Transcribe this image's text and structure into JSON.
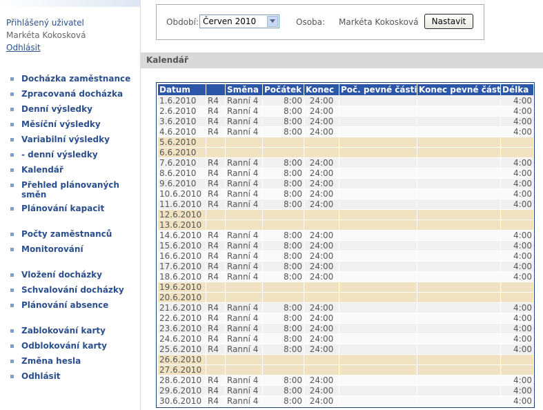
{
  "sidebar": {
    "user_title": "Přihlášený uživatel",
    "user_name": "Markéta Kokosková",
    "logout_label": "Odhlásit",
    "groups": [
      [
        "Docházka zaměstnance",
        "Zpracovaná docházka",
        "Denní výsledky",
        "Měsíční výsledky",
        "Variabilní výsledky",
        "- denní výsledky",
        "Kalendář",
        "Přehled plánovaných směn",
        "Plánování kapacit"
      ],
      [
        "Počty zaměstnanců",
        "Monitorování"
      ],
      [
        "Vložení docházky",
        "Schvalování docházky",
        "Plánování absence"
      ],
      [
        "Zablokování karty",
        "Odblokování karty",
        "Změna hesla",
        "Odhlásit"
      ]
    ]
  },
  "filter": {
    "period_label": "Období:",
    "period_value": "Červen 2010",
    "person_label": "Osoba:",
    "person_value": "Markéta Kokosková",
    "set_button": "Nastavit"
  },
  "section_title": "Kalendář",
  "calendar": {
    "headers": [
      "Datum",
      "",
      "Směna",
      "Počátek",
      "Konec",
      "Poč. pevné části",
      "Konec pevné části",
      "Délka"
    ],
    "rows": [
      [
        "1.6.2010",
        "R4",
        "Ranní 4",
        "8:00",
        "24:00",
        "",
        "",
        "4:00"
      ],
      [
        "2.6.2010",
        "R4",
        "Ranní 4",
        "8:00",
        "24:00",
        "",
        "",
        "4:00"
      ],
      [
        "3.6.2010",
        "R4",
        "Ranní 4",
        "8:00",
        "24:00",
        "",
        "",
        "4:00"
      ],
      [
        "4.6.2010",
        "R4",
        "Ranní 4",
        "8:00",
        "24:00",
        "",
        "",
        "4:00"
      ],
      [
        "5.6.2010",
        "",
        "",
        "",
        "",
        "",
        "",
        ""
      ],
      [
        "6.6.2010",
        "",
        "",
        "",
        "",
        "",
        "",
        ""
      ],
      [
        "7.6.2010",
        "R4",
        "Ranní 4",
        "8:00",
        "24:00",
        "",
        "",
        "4:00"
      ],
      [
        "8.6.2010",
        "R4",
        "Ranní 4",
        "8:00",
        "24:00",
        "",
        "",
        "4:00"
      ],
      [
        "9.6.2010",
        "R4",
        "Ranní 4",
        "8:00",
        "24:00",
        "",
        "",
        "4:00"
      ],
      [
        "10.6.2010",
        "R4",
        "Ranní 4",
        "8:00",
        "24:00",
        "",
        "",
        "4:00"
      ],
      [
        "11.6.2010",
        "R4",
        "Ranní 4",
        "8:00",
        "24:00",
        "",
        "",
        "4:00"
      ],
      [
        "12.6.2010",
        "",
        "",
        "",
        "",
        "",
        "",
        ""
      ],
      [
        "13.6.2010",
        "",
        "",
        "",
        "",
        "",
        "",
        ""
      ],
      [
        "14.6.2010",
        "R4",
        "Ranní 4",
        "8:00",
        "24:00",
        "",
        "",
        "4:00"
      ],
      [
        "15.6.2010",
        "R4",
        "Ranní 4",
        "8:00",
        "24:00",
        "",
        "",
        "4:00"
      ],
      [
        "16.6.2010",
        "R4",
        "Ranní 4",
        "8:00",
        "24:00",
        "",
        "",
        "4:00"
      ],
      [
        "17.6.2010",
        "R4",
        "Ranní 4",
        "8:00",
        "24:00",
        "",
        "",
        "4:00"
      ],
      [
        "18.6.2010",
        "R4",
        "Ranní 4",
        "8:00",
        "24:00",
        "",
        "",
        "4:00"
      ],
      [
        "19.6.2010",
        "",
        "",
        "",
        "",
        "",
        "",
        ""
      ],
      [
        "20.6.2010",
        "",
        "",
        "",
        "",
        "",
        "",
        ""
      ],
      [
        "21.6.2010",
        "R4",
        "Ranní 4",
        "8:00",
        "24:00",
        "",
        "",
        "4:00"
      ],
      [
        "22.6.2010",
        "R4",
        "Ranní 4",
        "8:00",
        "24:00",
        "",
        "",
        "4:00"
      ],
      [
        "23.6.2010",
        "R4",
        "Ranní 4",
        "8:00",
        "24:00",
        "",
        "",
        "4:00"
      ],
      [
        "24.6.2010",
        "R4",
        "Ranní 4",
        "8:00",
        "24:00",
        "",
        "",
        "4:00"
      ],
      [
        "25.6.2010",
        "R4",
        "Ranní 4",
        "8:00",
        "24:00",
        "",
        "",
        "4:00"
      ],
      [
        "26.6.2010",
        "",
        "",
        "",
        "",
        "",
        "",
        ""
      ],
      [
        "27.6.2010",
        "",
        "",
        "",
        "",
        "",
        "",
        ""
      ],
      [
        "28.6.2010",
        "R4",
        "Ranní 4",
        "8:00",
        "24:00",
        "",
        "",
        "4:00"
      ],
      [
        "29.6.2010",
        "R4",
        "Ranní 4",
        "8:00",
        "24:00",
        "",
        "",
        "4:00"
      ],
      [
        "30.6.2010",
        "R4",
        "Ranní 4",
        "8:00",
        "24:00",
        "",
        "",
        "4:00"
      ]
    ]
  },
  "colors": {
    "header_bg": "#2c56a7",
    "weekend_bg": "#f1e3c1",
    "link": "#2b4f8e"
  }
}
